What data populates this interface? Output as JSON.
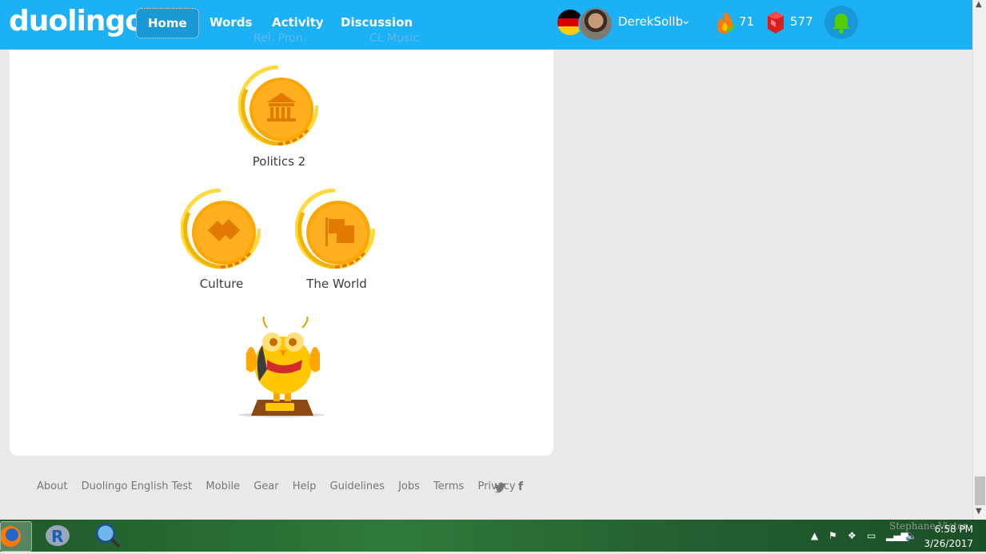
{
  "app": {
    "logo": "duolingo"
  },
  "nav": {
    "items": [
      {
        "label": "Home"
      },
      {
        "label": "Words"
      },
      {
        "label": "Activity"
      },
      {
        "label": "Discussion"
      }
    ],
    "ghost_labels": [
      "Rel. Pron.",
      "CL Music"
    ]
  },
  "user": {
    "name": "DerekSollb",
    "streak": "71",
    "gems": "577"
  },
  "skills": [
    {
      "label": "Politics 2",
      "icon": "parthenon-icon"
    },
    {
      "label": "Culture",
      "icon": "handshake-icon"
    },
    {
      "label": "The World",
      "icon": "flag-icon"
    }
  ],
  "footer": {
    "links": [
      "About",
      "Duolingo English Test",
      "Mobile",
      "Gear",
      "Help",
      "Guidelines",
      "Jobs",
      "Terms",
      "Privacy"
    ]
  },
  "taskbar": {
    "time": "6:58 PM",
    "date": "3/26/2017",
    "watermark": "Stephane Victor"
  },
  "colors": {
    "brand": "#1cb0f6",
    "gold": "#ffc800",
    "card": "#ffffff"
  }
}
